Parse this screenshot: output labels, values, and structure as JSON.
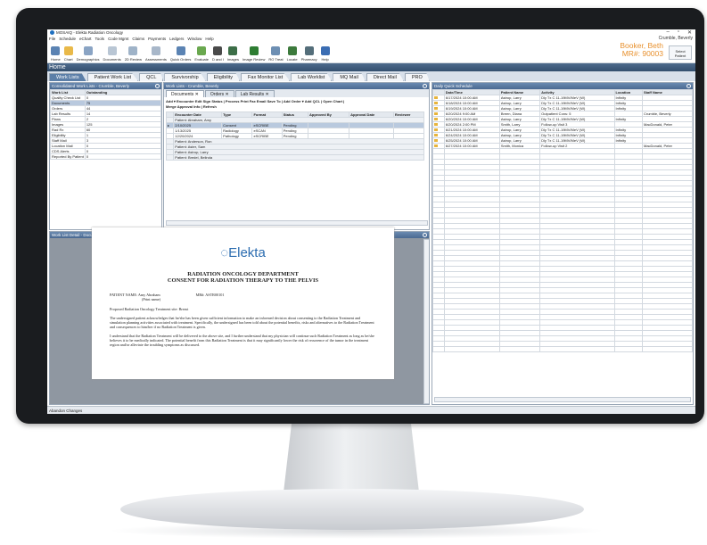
{
  "window": {
    "title": "MOSAIQ - Elekta Radiation Oncology",
    "user": "Crumble, Beverly"
  },
  "menu": [
    "File",
    "Schedule",
    "eChart",
    "Tools",
    "Code Mgmt",
    "Claims",
    "Payments",
    "Ledgers",
    "Window",
    "Help"
  ],
  "toolbar": [
    {
      "label": "Home",
      "color": "#5b83b3"
    },
    {
      "label": "Chart",
      "color": "#e9b949"
    },
    {
      "label": "Demographics",
      "color": "#8aa4c4"
    },
    {
      "label": "Documents",
      "color": "#b9c6d4"
    },
    {
      "label": "2D Review",
      "color": "#9fb3c8"
    },
    {
      "label": "Assessments",
      "color": "#a8b7c9"
    },
    {
      "label": "Quick Orders",
      "color": "#5b83b3"
    },
    {
      "label": "Evaluate",
      "color": "#6aa84f"
    },
    {
      "label": "D and I",
      "color": "#4a4a4a"
    },
    {
      "label": "Images",
      "color": "#3c6e47"
    },
    {
      "label": "Image Review",
      "color": "#2e7d32"
    },
    {
      "label": "RO Treat",
      "color": "#6d8fb3"
    },
    {
      "label": "Locate",
      "color": "#3c7a3c"
    },
    {
      "label": "Pharmacy",
      "color": "#546e7a"
    },
    {
      "label": "Help",
      "color": "#3b6db3"
    }
  ],
  "patient": {
    "name": "Booker, Beth",
    "mr": "MR#: 90003",
    "select_label": "Select Patient"
  },
  "home_label": "Home",
  "main_tabs": [
    "Work Lists",
    "Patient Work List",
    "QCL",
    "Survivorship",
    "Eligibility",
    "Fax Monitor List",
    "Lab Worklist",
    "MQ Mail",
    "Direct Mail",
    "PRO"
  ],
  "consolidated": {
    "title": "Consolidated Work Lists - Crumble, Beverly",
    "headers": [
      "Work List",
      "Outstanding"
    ],
    "rows": [
      [
        "Quality Check List",
        "0"
      ],
      [
        "Documents",
        "75"
      ],
      [
        "Orders",
        "44"
      ],
      [
        "Lab Results",
        "14"
      ],
      [
        "Plans",
        "2"
      ],
      [
        "Images",
        "125"
      ],
      [
        "Rad Rx",
        "60"
      ],
      [
        "Eligibility",
        "1"
      ],
      [
        "Staff Mail",
        "3"
      ],
      [
        "Location Mail",
        "0"
      ],
      [
        "CDS Alerts",
        "0"
      ],
      [
        "Reported By Patient",
        "0"
      ]
    ]
  },
  "worklists": {
    "title": "Work Lists - Crumble, Beverly",
    "tabs": [
      "Documents",
      "Orders",
      "Lab Results"
    ],
    "actions": "Add ▾  Encounter  Edit  Sign  Status  |  Process  Print  Fax  Email  Save To  |  Add Order ▾  Add QCL  |  Open Chart  |",
    "actions2": "Merge Approval Info  |  Refresh",
    "headers": [
      "Encounter Date",
      "Type",
      "Format",
      "Status",
      "Approved By",
      "Approval Date",
      "Reviewer"
    ],
    "rows": [
      {
        "group": "Patient: Abraham, Amy"
      },
      {
        "cells": [
          "2/10/2025",
          "Consent",
          "eSCRIBE",
          "Pending",
          "",
          "",
          ""
        ],
        "sel": true
      },
      {
        "cells": [
          "1/13/2025",
          "Radiology",
          "eSCAN",
          "Pending",
          "",
          "",
          ""
        ]
      },
      {
        "cells": [
          "12/20/2024",
          "Pathology",
          "eSCRIBE",
          "Pending",
          "",
          "",
          ""
        ]
      },
      {
        "group": "Patient: Anderson, Ron"
      },
      {
        "group": "Patient: Aster, Sam"
      },
      {
        "group": "Patient: Astrop, Larry"
      },
      {
        "group": "Patient: Bredel, Belinda"
      }
    ]
  },
  "detail": {
    "title": "Work List Detail - Documents",
    "logo": "Elekta",
    "dept": "RADIATION ONCOLOGY DEPARTMENT",
    "consent": "CONSENT FOR RADIATION THERAPY TO THE PELVIS",
    "patient_line": "PATIENT NAME: Amy Abraham",
    "mr_line": "MR#: ASTR00101",
    "print_name": "(Print name)",
    "treatment_line": "Proposed Radiation Oncology Treatment site: Breast",
    "p1": "The undersigned patient acknowledges that he/she has been given sufficient information to make an informed decision about consenting to the Radiation Treatment and simulation planning activities associated with treatment. Specifically, the undersigned has been told about the potential benefits, risks and alternatives to the Radiation Treatment and consequences to him/her if no Radiation Treatment is given.",
    "p2": "I understand that the Radiation Treatment will be delivered to the above site, and I further understand that my physician will continue such Radiation Treatment as long as he/she believes it to be medically indicated. The potential benefit from this Radiation Treatment is that it may significantly lower the risk of recurrence of the tumor in the treatment region and/or alleviate the troubling symptoms as discussed."
  },
  "schedule": {
    "title": "Daily Quick Schedule",
    "headers": [
      "Date/Time",
      "Patient Name",
      "Activity",
      "Location",
      "Staff Name"
    ],
    "rows": [
      [
        "6/17/2024 10:00 AM",
        "Astrop, Larry",
        "Dly Tx C 11-19MV/MeV (W)",
        "Infinity",
        ""
      ],
      [
        "6/18/2024 10:00 AM",
        "Astrop, Larry",
        "Dly Tx C 11-19MV/MeV (W)",
        "Infinity",
        ""
      ],
      [
        "6/19/2024 10:00 AM",
        "Astrop, Larry",
        "Dly Tx C 11-19MV/MeV (W)",
        "Infinity",
        ""
      ],
      [
        "6/20/2024 9:00 AM",
        "Breen, Diana",
        "Outpatient Cons: 5",
        "",
        "Crumble, Beverly"
      ],
      [
        "6/20/2024 10:00 AM",
        "Astrop, Larry",
        "Dly Tx C 11-19MV/MeV (W)",
        "Infinity",
        ""
      ],
      [
        "6/20/2024 2:00 PM",
        "Smith, Larry",
        "Follow-up Visit 3",
        "",
        "MacDonald, Peter"
      ],
      [
        "6/21/2024 10:00 AM",
        "Astrop, Larry",
        "Dly Tx C 11-19MV/MeV (W)",
        "Infinity",
        ""
      ],
      [
        "6/24/2024 10:00 AM",
        "Astrop, Larry",
        "Dly Tx C 11-19MV/MeV (W)",
        "Infinity",
        ""
      ],
      [
        "6/25/2024 10:00 AM",
        "Astrop, Larry",
        "Dly Tx C 11-19MV/MeV (W)",
        "Infinity",
        ""
      ],
      [
        "6/27/2024 10:00 AM",
        "Smith, Monica",
        "Follow-up Visit 2",
        "",
        "MacDonald, Peter"
      ]
    ]
  },
  "statusbar": "Abandon Changes"
}
